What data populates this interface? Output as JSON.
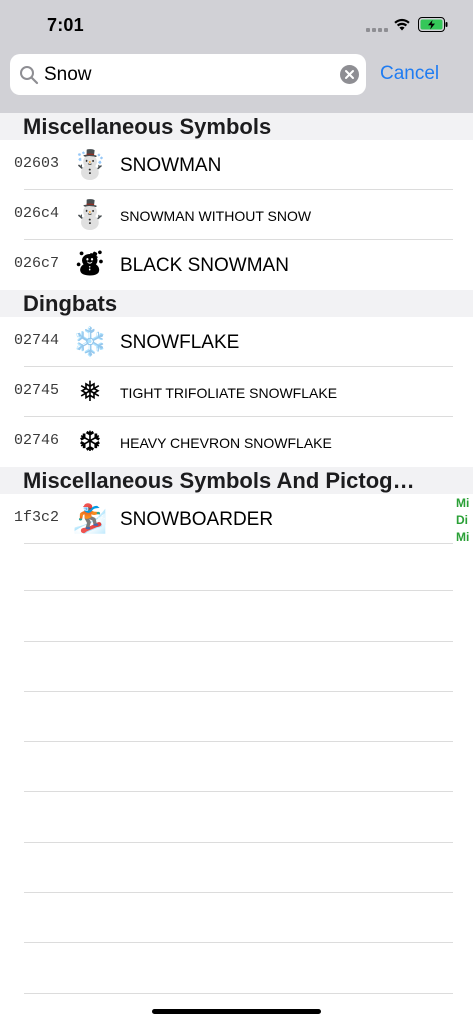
{
  "status_bar": {
    "time": "7:01",
    "battery_charging": true,
    "battery_color": "#34c759"
  },
  "search": {
    "value": "Snow",
    "placeholder": "Search",
    "cancel_label": "Cancel"
  },
  "colors": {
    "accent": "#1f7cf2",
    "badge_green": "#2aa036"
  },
  "sections": [
    {
      "title": "Miscellaneous Symbols",
      "rows": [
        {
          "code": "02603",
          "glyph": "☃️",
          "name": "SNOWMAN"
        },
        {
          "code": "026c4",
          "glyph": "⛄",
          "name": "SNOWMAN WITHOUT SNOW"
        },
        {
          "code": "026c7",
          "glyph": "⛇",
          "name": "BLACK SNOWMAN"
        }
      ]
    },
    {
      "title": "Dingbats",
      "rows": [
        {
          "code": "02744",
          "glyph": "❄️",
          "name": "SNOWFLAKE"
        },
        {
          "code": "02745",
          "glyph": "❅",
          "name": "TIGHT TRIFOLIATE SNOWFLAKE"
        },
        {
          "code": "02746",
          "glyph": "❆",
          "name": "HEAVY CHEVRON SNOWFLAKE"
        }
      ]
    },
    {
      "title": "Miscellaneous Symbols And Pictog…",
      "rows": [
        {
          "code": "1f3c2",
          "glyph": "🏂",
          "name": "SNOWBOARDER",
          "side_badge": [
            "Mi",
            "Di",
            "Mi"
          ]
        }
      ]
    }
  ]
}
